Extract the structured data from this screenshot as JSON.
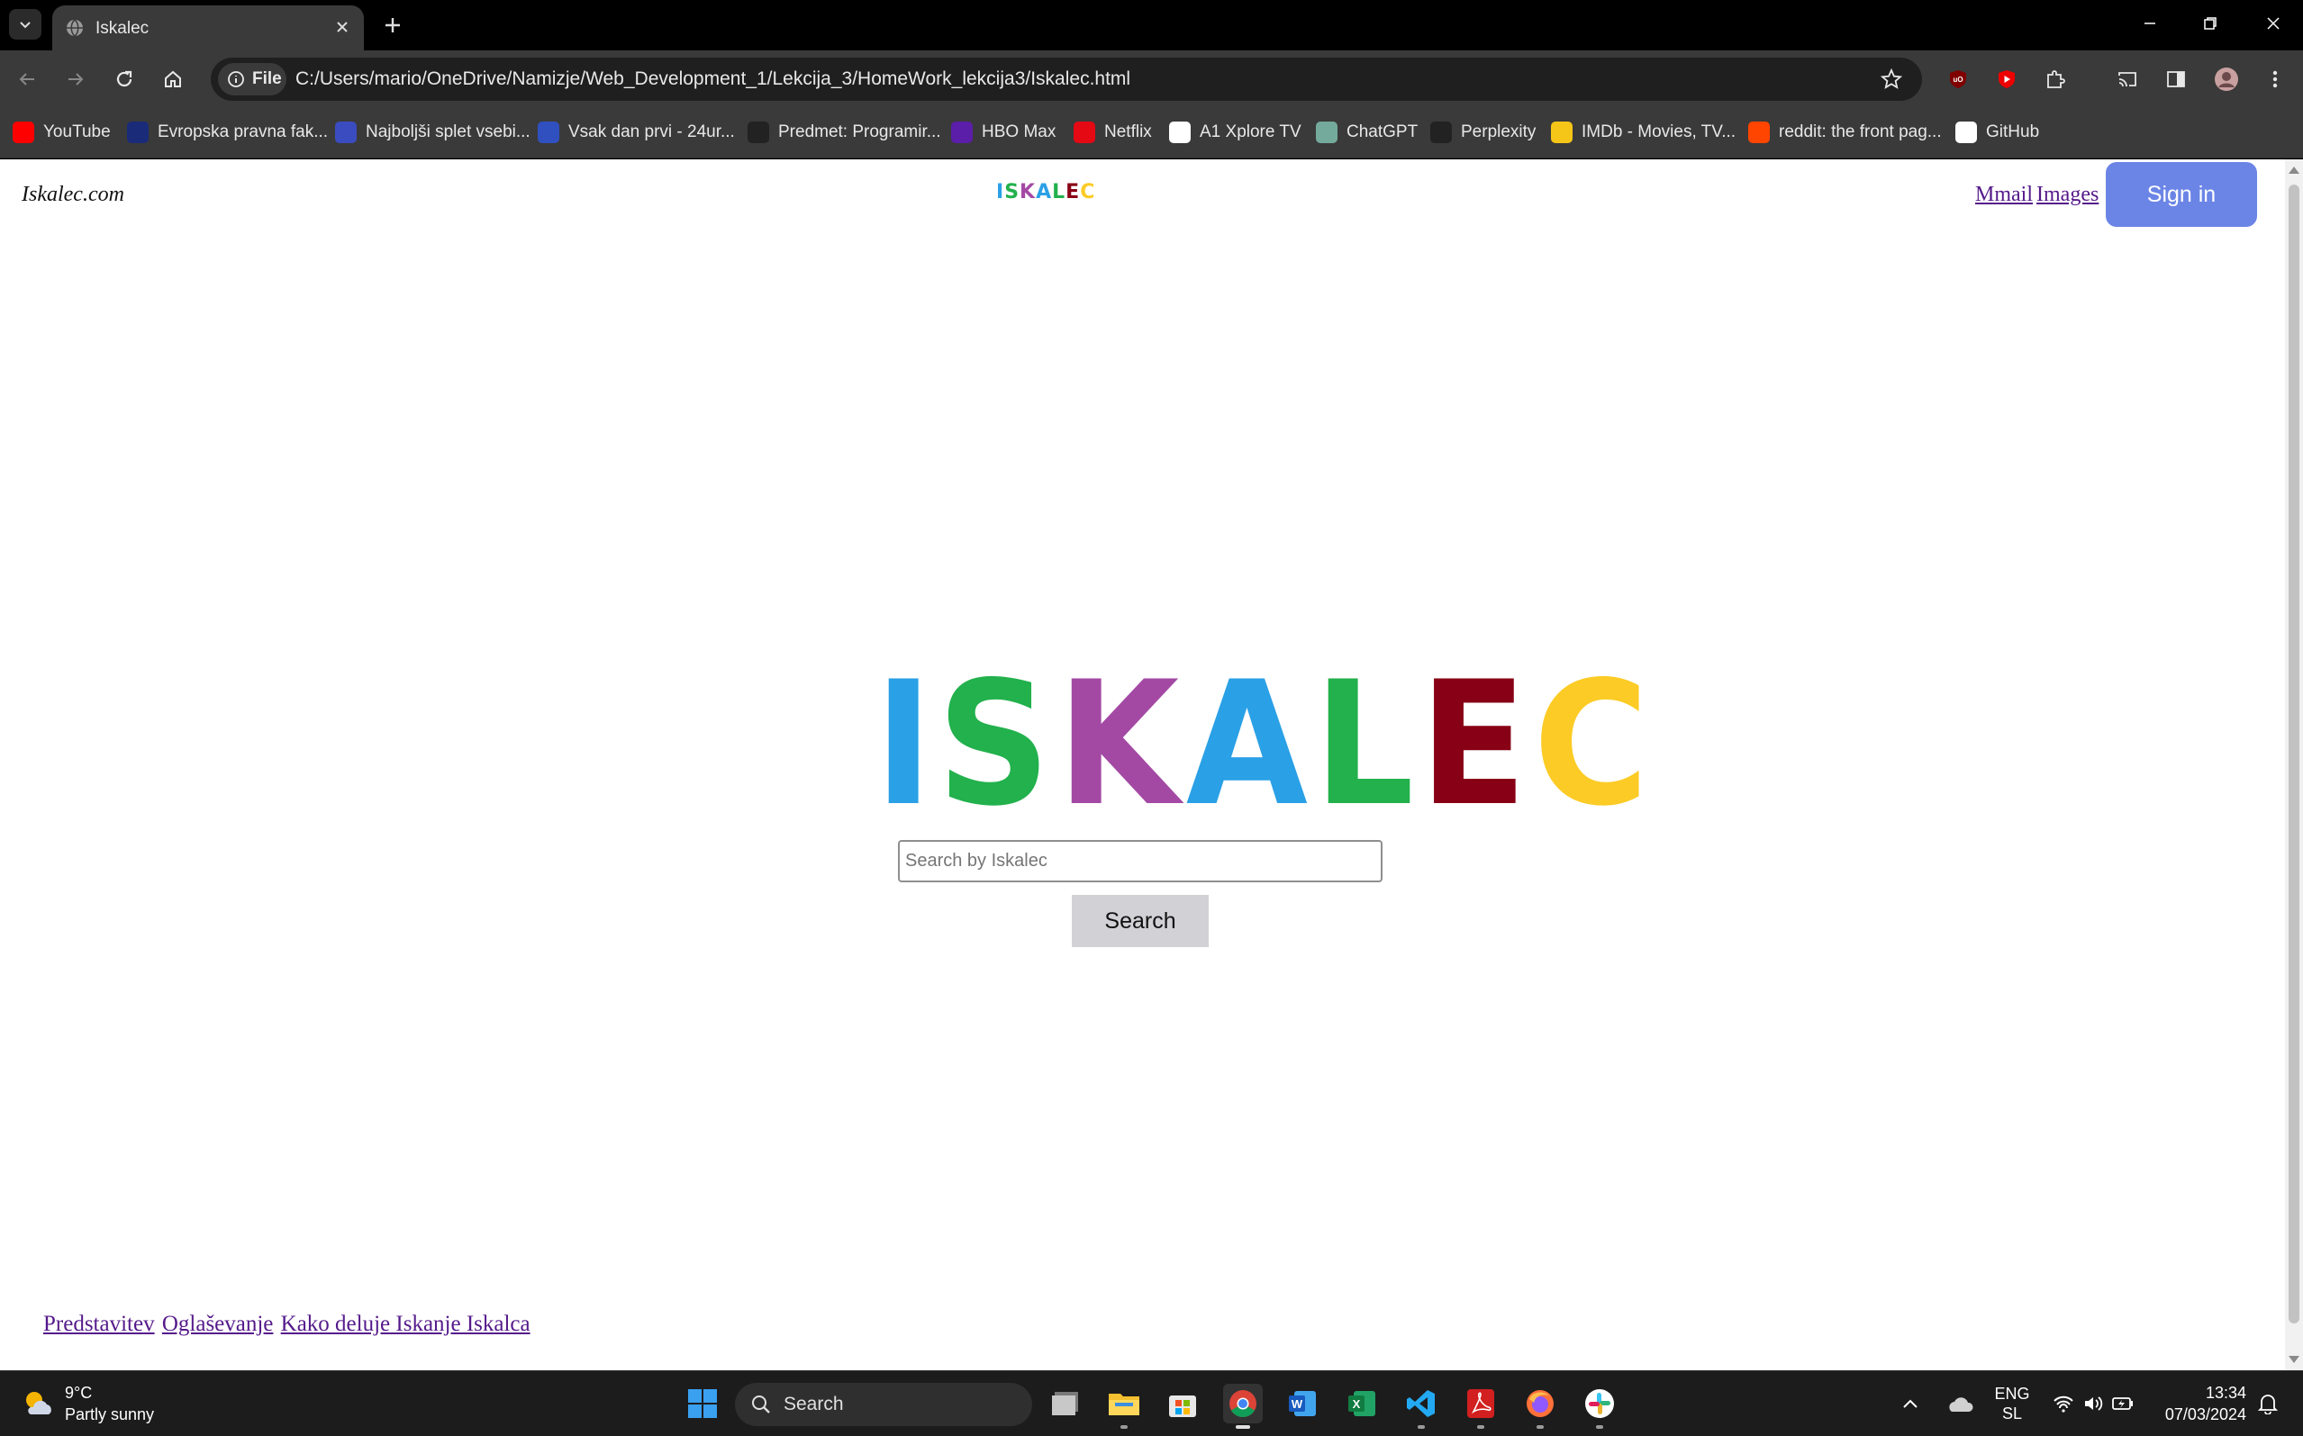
{
  "browser": {
    "tab_title": "Iskalec",
    "address_chip": "File",
    "url": "C:/Users/mario/OneDrive/Namizje/Web_Development_1/Lekcija_3/HomeWork_lekcija3/Iskalec.html"
  },
  "bookmarks": [
    {
      "label": "YouTube",
      "icon": "youtube-icon",
      "color": "#ff0000"
    },
    {
      "label": "Evropska pravna fak...",
      "icon": "epf-icon",
      "color": "#1a2b7a"
    },
    {
      "label": "Najboljši splet vsebi...",
      "icon": "najbolj-icon",
      "color": "#3b4cc0"
    },
    {
      "label": "Vsak dan prvi - 24ur...",
      "icon": "24ur-icon",
      "color": "#3050c0"
    },
    {
      "label": "Predmet: Programir...",
      "icon": "fri-icon",
      "color": "#222222"
    },
    {
      "label": "HBO Max",
      "icon": "hbo-icon",
      "color": "#5b1ea8"
    },
    {
      "label": "Netflix",
      "icon": "netflix-icon",
      "color": "#e50914"
    },
    {
      "label": "A1 Xplore TV",
      "icon": "a1-icon",
      "color": "#ffffff"
    },
    {
      "label": "ChatGPT",
      "icon": "chatgpt-icon",
      "color": "#74aa9c"
    },
    {
      "label": "Perplexity",
      "icon": "perplexity-icon",
      "color": "#222222"
    },
    {
      "label": "IMDb - Movies, TV...",
      "icon": "imdb-icon",
      "color": "#f5c518"
    },
    {
      "label": "reddit: the front pag...",
      "icon": "reddit-icon",
      "color": "#ff4500"
    },
    {
      "label": "GitHub",
      "icon": "github-icon",
      "color": "#ffffff"
    }
  ],
  "page": {
    "site_name": "Iskalec.com",
    "logo_letters": [
      {
        "ch": "I",
        "color": "#2aa0e6"
      },
      {
        "ch": "S",
        "color": "#22b14c"
      },
      {
        "ch": "K",
        "color": "#a349a4"
      },
      {
        "ch": "A",
        "color": "#2aa0e6"
      },
      {
        "ch": "L",
        "color": "#22b14c"
      },
      {
        "ch": "E",
        "color": "#880015"
      },
      {
        "ch": "C",
        "color": "#fccb25"
      }
    ],
    "top_links": [
      "Mmail",
      "Images"
    ],
    "signin_label": "Sign in",
    "search_placeholder": "Search by Iskalec",
    "search_button": "Search",
    "footer_links": [
      "Predstavitev",
      "Oglaševanje",
      "Kako deluje Iskanje Iskalca"
    ]
  },
  "taskbar": {
    "temperature": "9°C",
    "weather": "Partly sunny",
    "search_label": "Search",
    "lang_top": "ENG",
    "lang_bottom": "SL",
    "time": "13:34",
    "date": "07/03/2024"
  }
}
